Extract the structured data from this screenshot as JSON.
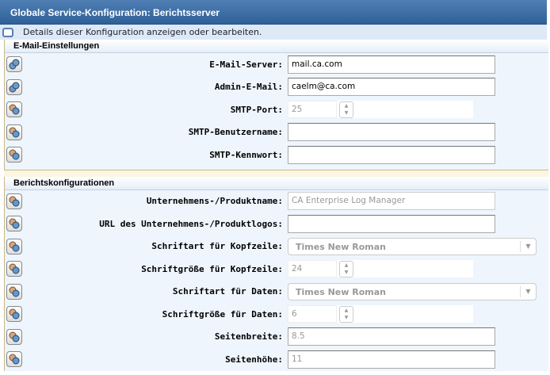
{
  "title": "Globale Service-Konfiguration: Berichtsserver",
  "info": "Details dieser Konfiguration anzeigen oder bearbeiten.",
  "email": {
    "header": "E-Mail-Einstellungen",
    "server_label": "E-Mail-Server:",
    "server_value": "mail.ca.com",
    "admin_label": "Admin-E-Mail:",
    "admin_value": "caelm@ca.com",
    "port_label": "SMTP-Port:",
    "port_value": "25",
    "user_label": "SMTP-Benutzername:",
    "user_value": "",
    "pass_label": "SMTP-Kennwort:",
    "pass_value": ""
  },
  "report": {
    "header": "Berichtskonfigurationen",
    "company_label": "Unternehmens-/Produktname:",
    "company_value": "CA Enterprise Log Manager",
    "logo_label": "URL des Unternehmens-/Produktlogos:",
    "logo_value": "",
    "head_font_label": "Schriftart für Kopfzeile:",
    "head_font_value": "Times New Roman",
    "head_size_label": "Schriftgröße für Kopfzeile:",
    "head_size_value": "24",
    "data_font_label": "Schriftart für Daten:",
    "data_font_value": "Times New Roman",
    "data_size_label": "Schriftgröße für Daten:",
    "data_size_value": "6",
    "width_label": "Seitenbreite:",
    "width_value": "8.5",
    "height_label": "Seitenhöhe:",
    "height_value": "11"
  }
}
